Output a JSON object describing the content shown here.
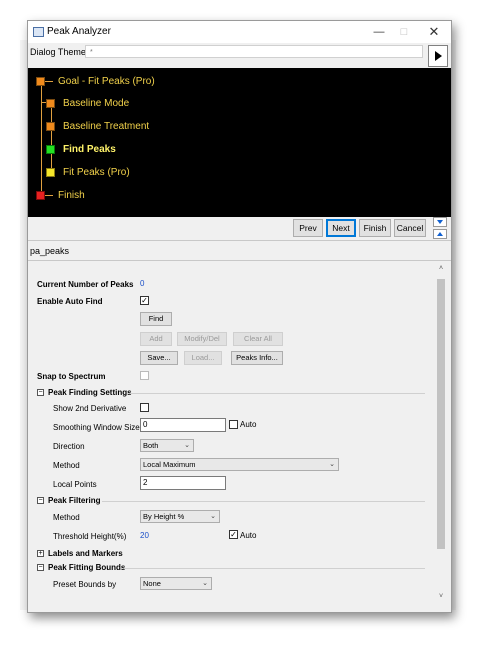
{
  "window": {
    "title": "Peak Analyzer"
  },
  "theme": {
    "label": "Dialog Theme",
    "value": "*"
  },
  "flow": {
    "steps": [
      {
        "label": "Goal - Fit Peaks (Pro)",
        "color": "#f08a1c"
      },
      {
        "label": "Baseline Mode",
        "color": "#f08a1c"
      },
      {
        "label": "Baseline Treatment",
        "color": "#f08a1c"
      },
      {
        "label": "Find Peaks",
        "color": "#22e022",
        "current": true
      },
      {
        "label": "Fit Peaks (Pro)",
        "color": "#f5e62a"
      },
      {
        "label": "Finish",
        "color": "#e62020"
      }
    ]
  },
  "nav": {
    "prev": "Prev",
    "next": "Next",
    "finish": "Finish",
    "cancel": "Cancel"
  },
  "panel_name": "pa_peaks",
  "props": {
    "current_peaks_label": "Current Number of Peaks",
    "current_peaks_value": "0",
    "auto_find_label": "Enable Auto Find",
    "auto_find_checked": true,
    "find_btn": "Find",
    "add_btn": "Add",
    "modify_btn": "Modify/Del",
    "clear_btn": "Clear All",
    "save_btn": "Save...",
    "load_btn": "Load...",
    "peaks_info_btn": "Peaks Info...",
    "snap_label": "Snap to Spectrum",
    "peak_finding_group": "Peak Finding Settings",
    "show_2nd_label": "Show 2nd Derivative",
    "smoothing_label": "Smoothing Window Size",
    "smoothing_value": "0",
    "auto_label": "Auto",
    "direction_label": "Direction",
    "direction_value": "Both",
    "method_label": "Method",
    "method_value": "Local Maximum",
    "local_points_label": "Local Points",
    "local_points_value": "2",
    "peak_filtering_group": "Peak Filtering",
    "filter_method_label": "Method",
    "filter_method_value": "By Height %",
    "threshold_label": "Threshold Height(%)",
    "threshold_value": "20",
    "threshold_auto_label": "Auto",
    "labels_group": "Labels and Markers",
    "bounds_group": "Peak Fitting Bounds",
    "preset_label": "Preset Bounds by",
    "preset_value": "None"
  }
}
